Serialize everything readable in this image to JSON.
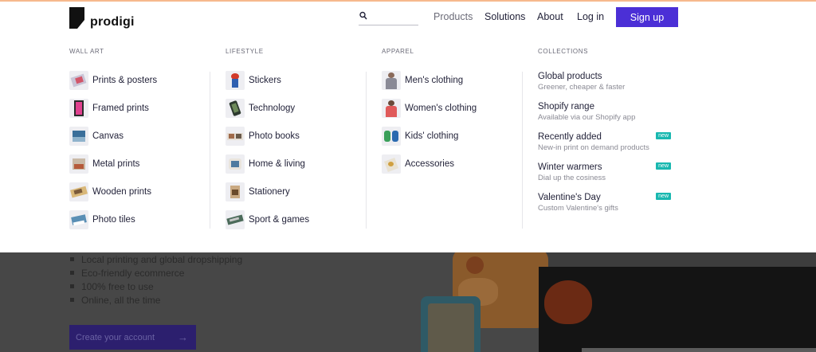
{
  "header": {
    "logo_text": "prodigi",
    "search_placeholder": "",
    "nav": {
      "products": "Products",
      "solutions": "Solutions",
      "about": "About",
      "login": "Log in",
      "signup": "Sign up"
    }
  },
  "menu": {
    "wall_art": {
      "heading": "WALL ART",
      "items": [
        "Prints & posters",
        "Framed prints",
        "Canvas",
        "Metal prints",
        "Wooden prints",
        "Photo tiles"
      ]
    },
    "lifestyle": {
      "heading": "LIFESTYLE",
      "items": [
        "Stickers",
        "Technology",
        "Photo books",
        "Home & living",
        "Stationery",
        "Sport & games"
      ]
    },
    "apparel": {
      "heading": "APPAREL",
      "items": [
        "Men's clothing",
        "Women's clothing",
        "Kids' clothing",
        "Accessories"
      ]
    },
    "collections": {
      "heading": "COLLECTIONS",
      "items": [
        {
          "title": "Global products",
          "subtitle": "Greener, cheaper & faster",
          "badge": ""
        },
        {
          "title": "Shopify range",
          "subtitle": "Available via our Shopify app",
          "badge": ""
        },
        {
          "title": "Recently added",
          "subtitle": "New-in print on demand products",
          "badge": "new"
        },
        {
          "title": "Winter warmers",
          "subtitle": "Dial up the cosiness",
          "badge": "new"
        },
        {
          "title": "Valentine's Day",
          "subtitle": "Custom Valentine's gifts",
          "badge": "new"
        }
      ]
    }
  },
  "hero": {
    "bullets": [
      "Local printing and global dropshipping",
      "Eco-friendly ecommerce",
      "100% free to use",
      "Online, all the time"
    ],
    "cta": "Create your account",
    "cta_arrow": "→"
  },
  "colors": {
    "accent": "#4b2fd6",
    "badge": "#19b8b0",
    "top_line": "#f6b98d"
  }
}
